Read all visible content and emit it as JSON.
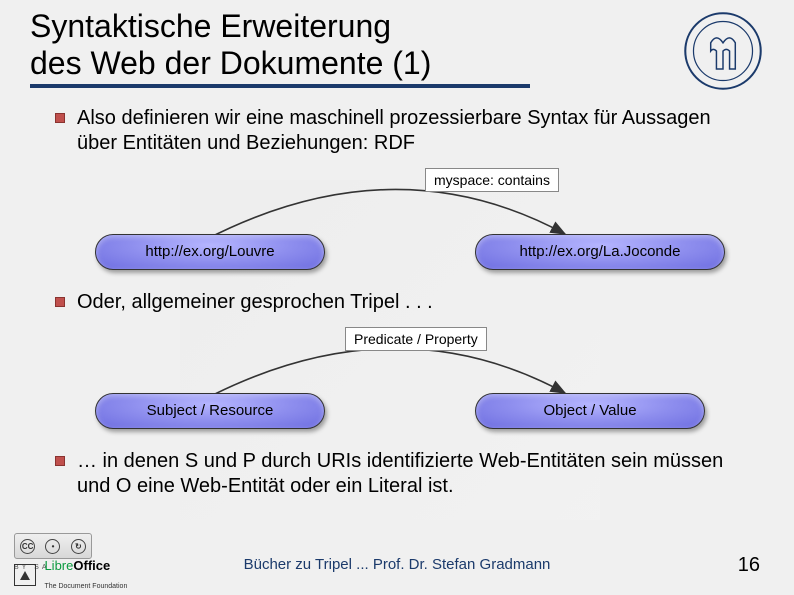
{
  "title_line1": "Syntaktische Erweiterung",
  "title_line2": "des Web der Dokumente (1)",
  "bullets": [
    "Also definieren wir eine maschinell prozessierbare Syntax für Aussagen über Entitäten und Beziehungen: RDF",
    "Oder, allgemeiner gesprochen Tripel . . .",
    "… in denen S und P durch URIs identifizierte Web-Entitäten sein müssen und O eine Web-Entität oder ein Literal ist."
  ],
  "diagram1": {
    "subject": "http://ex.org/Louvre",
    "predicate": "myspace: contains",
    "object": "http://ex.org/La.Joconde"
  },
  "diagram2": {
    "subject": "Subject / Resource",
    "predicate": "Predicate / Property",
    "object": "Object / Value"
  },
  "footer": {
    "cc_labels": "BY   SA",
    "libre_green": "Libre",
    "libre_bold": "Office",
    "libre_sub": "The Document Foundation",
    "center": "Bücher zu Tripel ... Prof. Dr. Stefan Gradmann",
    "page": "16"
  }
}
